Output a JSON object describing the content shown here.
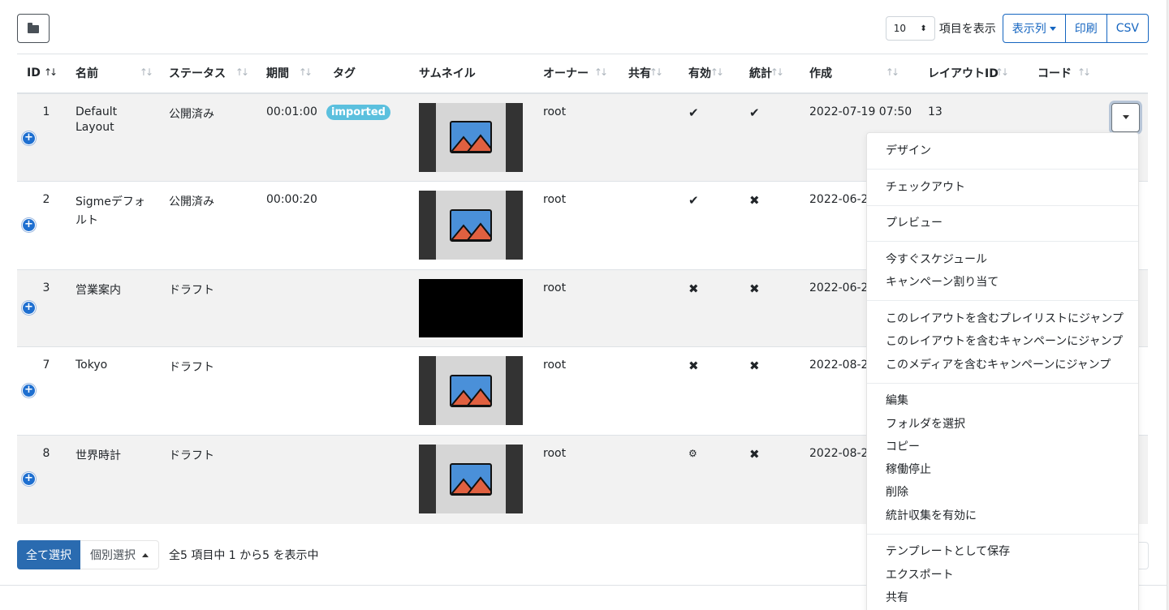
{
  "toolbar": {
    "page_length": "10",
    "length_label": "項目を表示",
    "columns_button": "表示列",
    "print_button": "印刷",
    "csv_button": "CSV"
  },
  "table": {
    "headers": [
      "ID",
      "名前",
      "ステータス",
      "期間",
      "タグ",
      "サムネイル",
      "オーナー",
      "共有",
      "有効",
      "統計",
      "作成",
      "レイアウトID",
      "コード"
    ],
    "rows": [
      {
        "id": "1",
        "name_line1": "Default",
        "name_line2": "Layout",
        "status": "公開済み",
        "duration": "00:01:00",
        "tag": "imported",
        "thumb": "image",
        "owner": "root",
        "enabled": "✔",
        "stats": "✔",
        "created": "2022-07-19 07:50",
        "layout_id": "13"
      },
      {
        "id": "2",
        "name_line1": "Sigmeデフォ",
        "name_line2": "ルト",
        "status": "公開済み",
        "duration": "00:00:20",
        "tag": "",
        "thumb": "image",
        "owner": "root",
        "enabled": "✔",
        "stats": "✖",
        "created": "2022-06-2",
        "layout_id": ""
      },
      {
        "id": "3",
        "name_line1": "営業案内",
        "name_line2": "",
        "status": "ドラフト",
        "duration": "",
        "tag": "",
        "thumb": "black",
        "owner": "root",
        "enabled": "✖",
        "stats": "✖",
        "created": "2022-06-2",
        "layout_id": ""
      },
      {
        "id": "7",
        "name_line1": "Tokyo",
        "name_line2": "",
        "status": "ドラフト",
        "duration": "",
        "tag": "",
        "thumb": "image",
        "owner": "root",
        "enabled": "✖",
        "stats": "✖",
        "created": "2022-08-2",
        "layout_id": ""
      },
      {
        "id": "8",
        "name_line1": "世界時計",
        "name_line2": "",
        "status": "ドラフト",
        "duration": "",
        "tag": "",
        "thumb": "image",
        "owner": "root",
        "enabled": "⚙",
        "stats": "✖",
        "created": "2022-08-2",
        "layout_id": ""
      }
    ]
  },
  "footer": {
    "select_all": "全て選択",
    "select_individual": "個別選択",
    "info": "全5 項目中 1 から5 を表示中"
  },
  "menu": {
    "groups": [
      [
        "デザイン"
      ],
      [
        "チェックアウト"
      ],
      [
        "プレビュー"
      ],
      [
        "今すぐスケジュール",
        "キャンペーン割り当て"
      ],
      [
        "このレイアウトを含むプレイリストにジャンプ",
        "このレイアウトを含むキャンペーンにジャンプ",
        "このメディアを含むキャンペーンにジャンプ"
      ],
      [
        "編集",
        "フォルダを選択",
        "コピー",
        "稼働停止",
        "削除",
        "統計収集を有効に"
      ],
      [
        "テンプレートとして保存",
        "エクスポート",
        "共有"
      ]
    ]
  },
  "colors": {
    "primary": "#2a6bb0",
    "outline_blue": "#1565c0",
    "badge": "#5bc0de",
    "row_striped": "#f2f2f2"
  }
}
